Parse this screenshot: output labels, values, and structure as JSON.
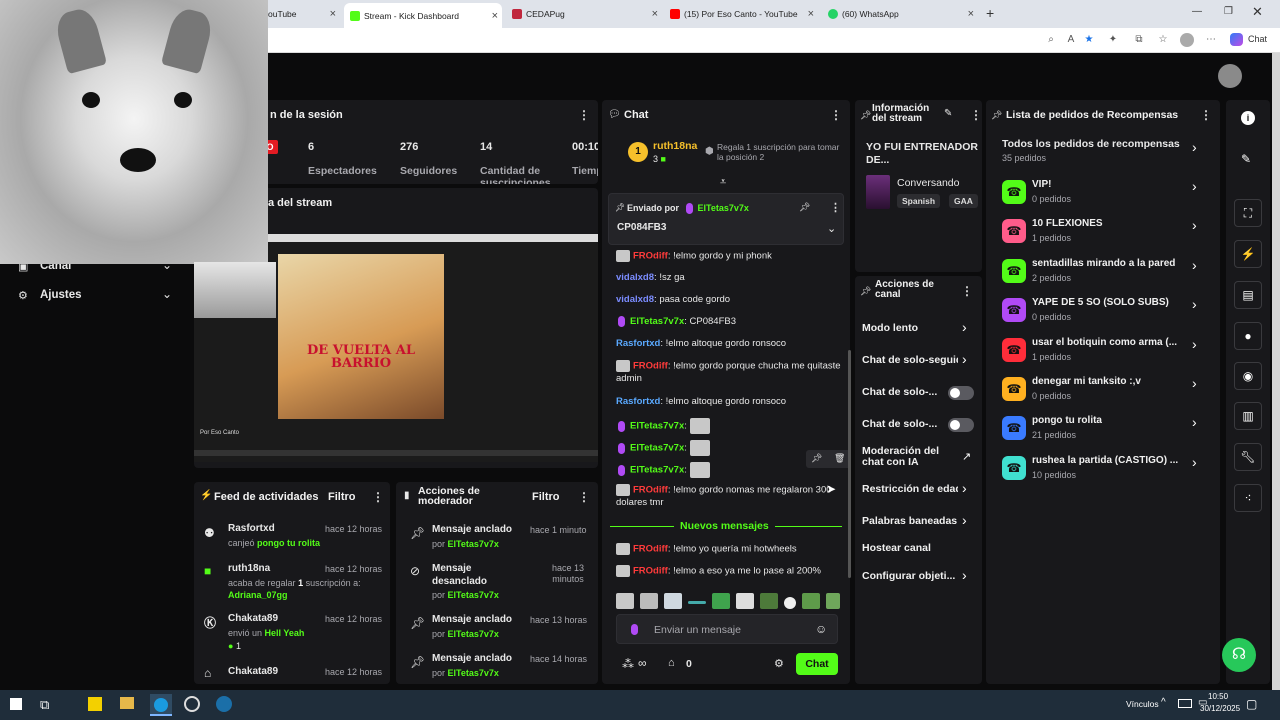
{
  "browser": {
    "tabs": [
      {
        "label": "ouTube"
      },
      {
        "label": "Stream - Kick Dashboard"
      },
      {
        "label": "CEDAPug"
      },
      {
        "label": "(15) Por Eso Canto - YouTube"
      },
      {
        "label": "(60) WhatsApp"
      }
    ],
    "chat_btn": "Chat"
  },
  "session": {
    "title": "n de la sesión",
    "live_badge": "DO",
    "stats": [
      {
        "value": "6",
        "label": "Espectadores"
      },
      {
        "value": "276",
        "label": "Seguidores"
      },
      {
        "value": "14",
        "label": "Cantidad de suscripciones"
      },
      {
        "value": "00:10",
        "label": "Tiemp"
      }
    ]
  },
  "preview": {
    "title": "a del stream"
  },
  "nav": {
    "items": [
      {
        "label": "Canal"
      },
      {
        "label": "Ajustes"
      }
    ]
  },
  "feed": {
    "title": "Feed de actividades",
    "filter": "Filtro",
    "items": [
      {
        "user": "Rasfortxd",
        "time": "hace 12 horas",
        "text": "canjeó",
        "highlight": "pongo tu rolita",
        "extra": ""
      },
      {
        "user": "ruth18na",
        "time": "hace 12 horas",
        "text": "acaba de regalar",
        "count": "1",
        "text2": "suscripción a:",
        "highlight": "Adriana_07gg",
        "extra": ""
      },
      {
        "user": "Chakata89",
        "time": "hace 12 horas",
        "text": "envió un",
        "highlight": "Hell Yeah",
        "extra": "1"
      },
      {
        "user": "Chakata89",
        "time": "hace 12 horas",
        "text": "",
        "highlight": "",
        "extra": ""
      }
    ]
  },
  "modactions": {
    "title": "Acciones de moderador",
    "filter": "Filtro",
    "items": [
      {
        "action": "Mensaje anclado",
        "time": "hace 1 minuto",
        "by": "por",
        "user": "ElTetas7v7x"
      },
      {
        "action": "Mensaje desanclado",
        "time": "hace 13 minutos",
        "by": "por",
        "user": "ElTetas7v7x"
      },
      {
        "action": "Mensaje anclado",
        "time": "hace 13 horas",
        "by": "por",
        "user": "ElTetas7v7x"
      },
      {
        "action": "Mensaje anclado",
        "time": "hace 14 horas",
        "by": "por",
        "user": "ElTetas7v7x"
      }
    ]
  },
  "chat": {
    "title": "Chat",
    "top_rank": "1",
    "top_user": "ruth18na",
    "top_count": "3",
    "gift_prompt": "Regala 1 suscripción para tomar la posición 2",
    "pinned": {
      "label": "Enviado por",
      "user": "ElTetas7v7x",
      "message": "CP084FB3"
    },
    "messages": [
      {
        "user": "FROdiff",
        "color": "#ff3b3b",
        "text": "!elmo gordo y mi phonk"
      },
      {
        "user": "vidalxd8",
        "color": "#7b8cff",
        "text": "!sz ga"
      },
      {
        "user": "vidalxd8",
        "color": "#7b8cff",
        "text": "pasa code gordo"
      },
      {
        "user": "ElTetas7v7x",
        "color": "#53fc18",
        "text": "CP084FB3"
      },
      {
        "user": "Rasfortxd",
        "color": "#5aa9ff",
        "text": "!elmo altoque gordo ronsoco"
      },
      {
        "user": "FROdiff",
        "color": "#ff3b3b",
        "text": "!elmo gordo porque chucha me quitaste admin"
      },
      {
        "user": "Rasfortxd",
        "color": "#5aa9ff",
        "text": "!elmo altoque gordo ronsoco"
      },
      {
        "user": "ElTetas7v7x",
        "color": "#53fc18",
        "text": ""
      },
      {
        "user": "ElTetas7v7x",
        "color": "#53fc18",
        "text": ""
      },
      {
        "user": "ElTetas7v7x",
        "color": "#53fc18",
        "text": ""
      },
      {
        "user": "FROdiff",
        "color": "#ff3b3b",
        "text": "!elmo gordo nomas me regalaron 300 dolares tmr"
      }
    ],
    "new_messages": "Nuevos mensajes",
    "new": [
      {
        "user": "FROdiff",
        "color": "#ff3b3b",
        "text": "!elmo yo quería mi hotwheels"
      },
      {
        "user": "FROdiff",
        "color": "#ff3b3b",
        "text": "!elmo a eso ya me lo pase al 200%"
      }
    ],
    "placeholder": "Enviar un mensaje",
    "points": "0",
    "send": "Chat"
  },
  "streaminfo": {
    "title": "Información del stream",
    "stream_title": "YO FUI ENTRENADOR DE...",
    "category": "Conversando",
    "tags": [
      "Spanish",
      "GAA"
    ]
  },
  "channel_actions": {
    "title": "Acciones de canal",
    "items": [
      {
        "label": "Modo lento",
        "type": "chevron"
      },
      {
        "label": "Chat de solo-seguid",
        "type": "chevron"
      },
      {
        "label": "Chat de solo-...",
        "type": "toggle"
      },
      {
        "label": "Chat de solo-...",
        "type": "toggle"
      },
      {
        "label": "Moderación del chat con IA",
        "type": "external"
      },
      {
        "label": "Restricción de edad",
        "type": "chevron"
      },
      {
        "label": "Palabras baneadas",
        "type": "chevron"
      },
      {
        "label": "Hostear canal",
        "type": "none"
      },
      {
        "label": "Configurar objeti...",
        "type": "chevron"
      }
    ]
  },
  "rewards": {
    "title": "Lista de pedidos de Recompensas",
    "all": {
      "name": "Todos los pedidos de recompensas",
      "count": "35 pedidos"
    },
    "items": [
      {
        "name": "VIP!",
        "count": "0 pedidos",
        "color": "#53fc18"
      },
      {
        "name": "10 FLEXIONES",
        "count": "1 pedidos",
        "color": "#ff5c8a"
      },
      {
        "name": "sentadillas mirando a la pared",
        "count": "2 pedidos",
        "color": "#53fc18"
      },
      {
        "name": "YAPE DE 5 SO (SOLO SUBS)",
        "count": "0 pedidos",
        "color": "#b04af5"
      },
      {
        "name": "usar el botiquin como arma (...",
        "count": "1 pedidos",
        "color": "#ff2d3a"
      },
      {
        "name": "denegar mi tanksito :,v",
        "count": "0 pedidos",
        "color": "#ffb020"
      },
      {
        "name": "pongo tu rolita",
        "count": "21 pedidos",
        "color": "#3a7bff"
      },
      {
        "name": "rushea la partida (CASTIGO) ...",
        "count": "10 pedidos",
        "color": "#40e0d0"
      }
    ]
  },
  "video": {
    "film_title": "DE VUELTA AL BARRIO",
    "channel": "Por Eso Canto"
  },
  "taskbar": {
    "links": "Vínculos",
    "time": "10:50",
    "date": "30/12/2025"
  }
}
